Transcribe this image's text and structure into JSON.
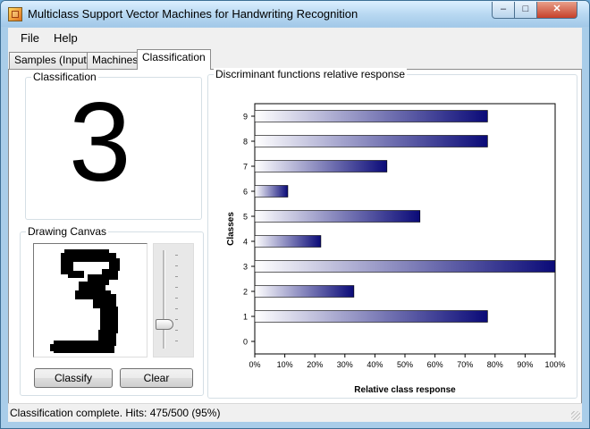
{
  "window": {
    "title": "Multiclass Support Vector Machines for Handwriting Recognition"
  },
  "menu": {
    "items": [
      "File",
      "Help"
    ]
  },
  "tabs": [
    "Samples (Input)",
    "Machines",
    "Classification"
  ],
  "classification": {
    "label": "Classification",
    "result": "3"
  },
  "drawing": {
    "label": "Drawing Canvas",
    "classify_label": "Classify",
    "clear_label": "Clear"
  },
  "chart_panel": {
    "label": "Discriminant functions relative response"
  },
  "chart_data": {
    "type": "bar",
    "orientation": "horizontal",
    "categories": [
      "0",
      "1",
      "2",
      "3",
      "4",
      "5",
      "6",
      "7",
      "8",
      "9"
    ],
    "values": [
      0,
      77.5,
      33,
      100,
      22,
      55,
      11,
      44,
      77.5,
      77.5
    ],
    "xlabel": "Relative class response",
    "ylabel": "Classes",
    "xlim": [
      0,
      100
    ],
    "xticks": [
      "0%",
      "10%",
      "20%",
      "30%",
      "40%",
      "50%",
      "60%",
      "70%",
      "80%",
      "90%",
      "100%"
    ],
    "bar_gradient": [
      "#ffffff",
      "#0a0a78"
    ]
  },
  "status": {
    "text": "Classification complete. Hits: 475/500 (95%)"
  }
}
